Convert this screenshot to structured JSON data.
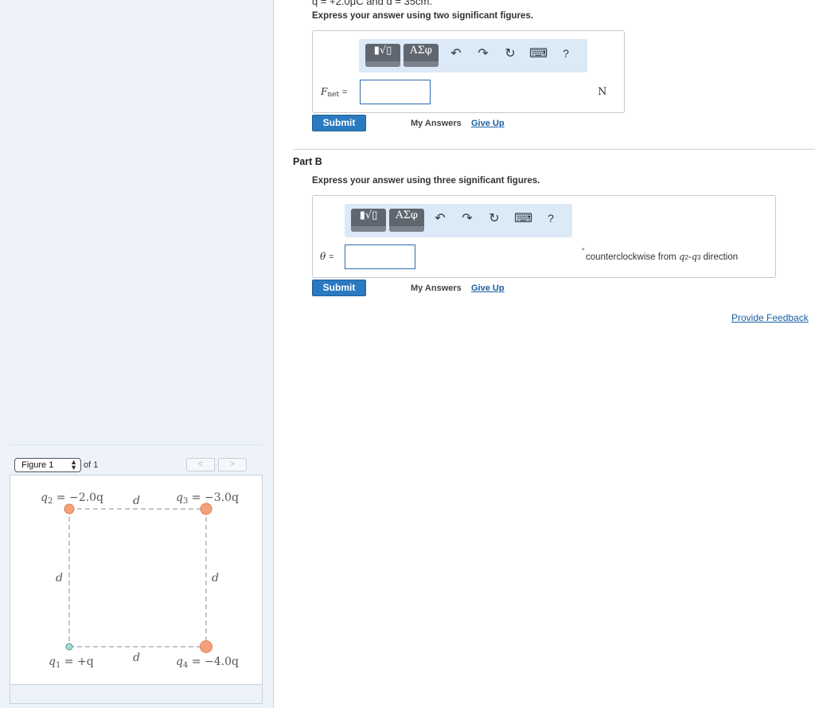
{
  "top_cut_text": "q = +2.0μC and d = 35cm.",
  "part_a": {
    "instruction": "Express your answer using two significant figures.",
    "toolbar": {
      "template_btn": "▮√▯",
      "greek_btn": "ΑΣφ",
      "undo": "↶",
      "redo": "↷",
      "reset": "↻",
      "keyboard": "⌨",
      "help": "?"
    },
    "var_main": "F",
    "var_sub": "net",
    "eq": "=",
    "input_value": "",
    "unit": "N",
    "submit": "Submit",
    "my_answers": "My Answers",
    "give_up": "Give Up"
  },
  "part_b": {
    "title": "Part B",
    "instruction": "Express your answer using three significant figures.",
    "toolbar": {
      "template_btn": "▮√▯",
      "greek_btn": "ΑΣφ",
      "undo": "↶",
      "redo": "↷",
      "reset": "↻",
      "keyboard": "⌨",
      "help": "?"
    },
    "var_main": "θ",
    "eq": "=",
    "input_value": "",
    "degree": "°",
    "ccw_prefix": "counterclockwise from ",
    "ccw_q2": "q",
    "ccw_q2_sub": "2",
    "ccw_dash": "-",
    "ccw_q3": "q",
    "ccw_q3_sub": "3",
    "ccw_suffix": " direction",
    "submit": "Submit",
    "my_answers": "My Answers",
    "give_up": "Give Up"
  },
  "feedback": "Provide Feedback",
  "figure": {
    "select_label": "Figure 1",
    "of_label": "of 1",
    "prev": "<",
    "next": ">",
    "q2_label": "q",
    "q2_sub": "2",
    "q2_value": " = −2.0q",
    "q3_label": "q",
    "q3_sub": "3",
    "q3_value": " = −3.0q",
    "q1_label": "q",
    "q1_sub": "1",
    "q1_value": " = +q",
    "q4_label": "q",
    "q4_sub": "4",
    "q4_value": " = −4.0q",
    "d_label": "d",
    "colors": {
      "negative_charge": "#f4a07a",
      "positive_charge": "#a8ddd6",
      "dashes": "#888888"
    }
  }
}
